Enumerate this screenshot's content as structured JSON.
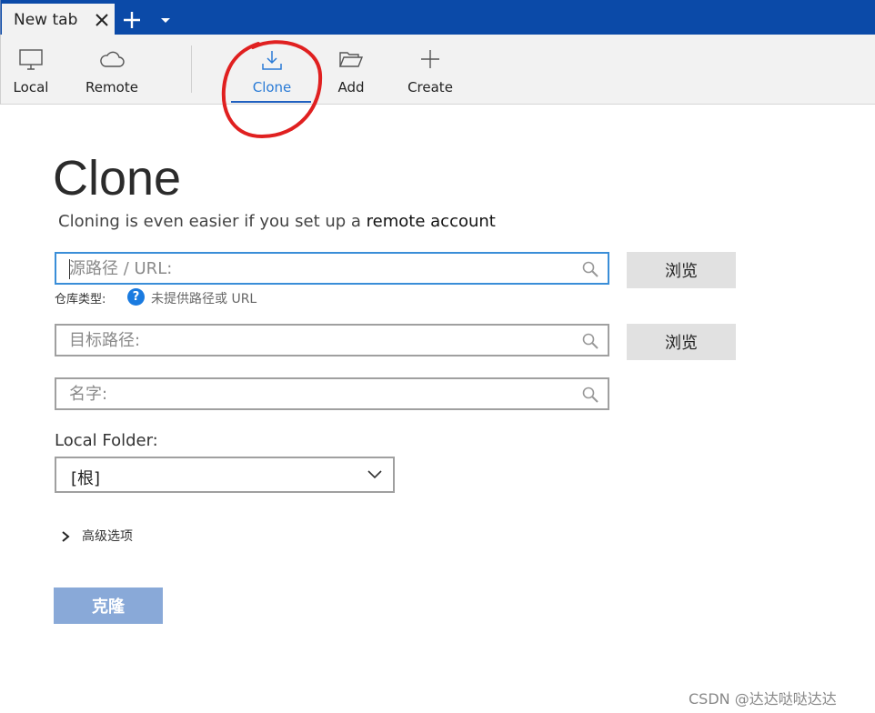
{
  "tabbar": {
    "tab_label": "New tab",
    "colors": {
      "bar": "#0b4aa8",
      "tab": "#f2f2f2"
    }
  },
  "toolbar": {
    "items": [
      {
        "label": "Local",
        "icon": "monitor-icon"
      },
      {
        "label": "Remote",
        "icon": "cloud-icon"
      },
      {
        "label": "Clone",
        "icon": "download-icon",
        "active": true
      },
      {
        "label": "Add",
        "icon": "folder-open-icon"
      },
      {
        "label": "Create",
        "icon": "plus-icon"
      }
    ],
    "accent": "#2a7bd6"
  },
  "page": {
    "title": "Clone",
    "subtitle_prefix": "Cloning is even easier if you set up a ",
    "subtitle_link": "remote account"
  },
  "form": {
    "source": {
      "placeholder": "源路径 / URL:",
      "browse_label": "浏览"
    },
    "repo_type": {
      "label": "仓库类型:",
      "hint": "未提供路径或 URL",
      "help_glyph": "?"
    },
    "dest": {
      "placeholder": "目标路径:",
      "browse_label": "浏览"
    },
    "name": {
      "placeholder": "名字:"
    },
    "local_folder": {
      "label": "Local Folder:",
      "value": "[根]"
    },
    "advanced_label": "高级选项",
    "clone_label": "克隆",
    "clone_color": "#89a9d8"
  },
  "watermark": "CSDN @达达哒哒达达"
}
